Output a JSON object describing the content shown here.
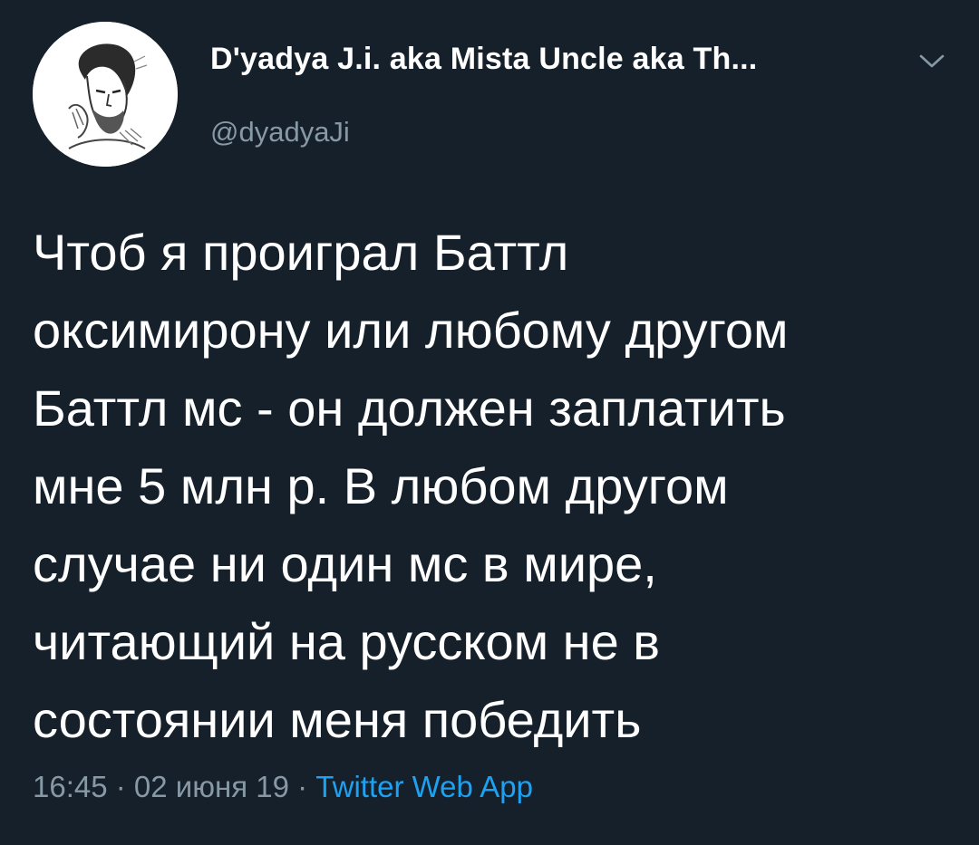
{
  "author": {
    "display_name": "D'yadya J.i. aka Mista Uncle aka Th...",
    "handle": "@dyadyaJi",
    "avatar_icon": "profile-portrait-sketch"
  },
  "menu": {
    "icon": "chevron-down-icon"
  },
  "tweet": {
    "text": "Чтоб я проиграл Баттл\nоксимирону или любому другом\nБаттл мс - он должен заплатить\nмне 5 млн р. В любом другом\nслучае ни один мс в мире,\nчитающий на русском не в\nсостоянии меня победить"
  },
  "meta": {
    "time": "16:45",
    "separator": " · ",
    "date": "02 июня 19",
    "source": "Twitter Web App"
  },
  "colors": {
    "background": "#15202b",
    "text": "#ffffff",
    "secondary": "#8899a6",
    "link": "#1da1f2"
  }
}
